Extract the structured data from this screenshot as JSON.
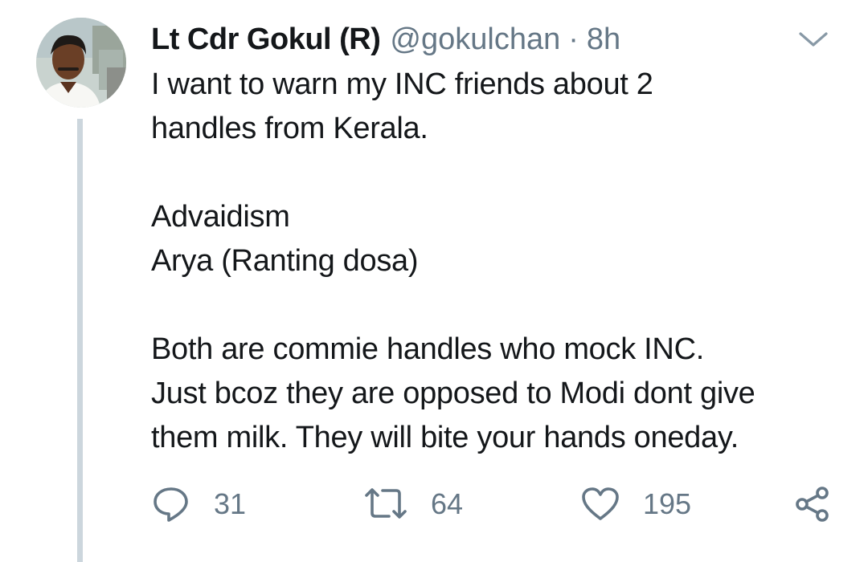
{
  "tweet": {
    "author": {
      "display_name": "Lt Cdr Gokul (R)",
      "handle": "@gokulchan",
      "avatar_icon": "user-avatar"
    },
    "separator": "·",
    "time": "8h",
    "menu_icon": "chevron-down-icon",
    "text_lines": [
      "I want to warn my INC friends about 2",
      "handles from Kerala.",
      "",
      "Advaidism",
      "Arya (Ranting dosa)",
      "",
      "Both are commie handles who mock INC.",
      "Just bcoz they are opposed to Modi dont give",
      "them milk. They will bite your hands oneday."
    ],
    "actions": {
      "reply": {
        "icon": "reply-icon",
        "count": "31"
      },
      "retweet": {
        "icon": "retweet-icon",
        "count": "64"
      },
      "like": {
        "icon": "heart-icon",
        "count": "195"
      },
      "share": {
        "icon": "share-icon"
      }
    },
    "colors": {
      "text": "#14171a",
      "secondary": "#657786",
      "thread_line": "#ccd6dd"
    }
  }
}
